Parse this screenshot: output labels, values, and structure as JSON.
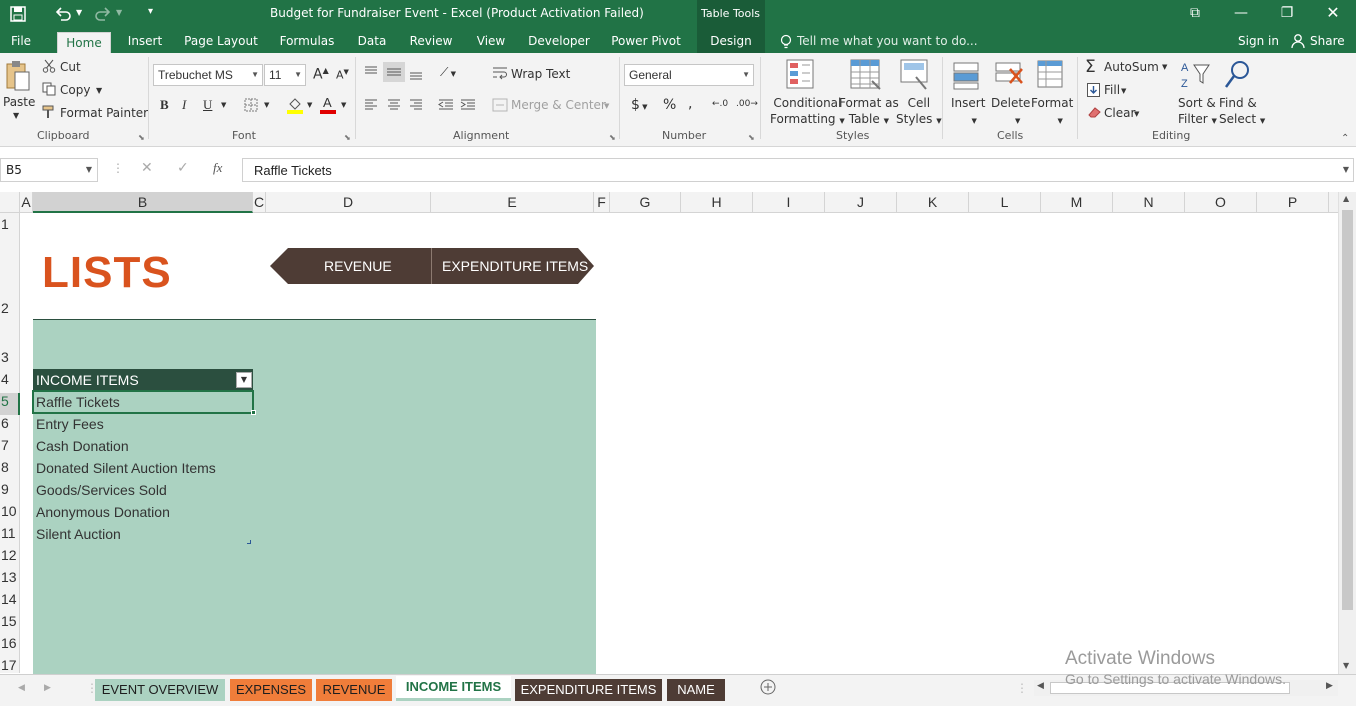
{
  "title_bar": {
    "doc_title": "Budget for Fundraiser Event - Excel (Product Activation Failed)",
    "context_tab": "Table Tools",
    "sign_in": "Sign in",
    "share": "Share"
  },
  "ribbon_tabs": [
    "File",
    "Home",
    "Insert",
    "Page Layout",
    "Formulas",
    "Data",
    "Review",
    "View",
    "Developer",
    "Power Pivot",
    "Design"
  ],
  "tell_me": "Tell me what you want to do...",
  "clipboard": {
    "paste": "Paste",
    "cut": "Cut",
    "copy": "Copy",
    "format_painter": "Format Painter",
    "label": "Clipboard"
  },
  "font": {
    "name": "Trebuchet MS",
    "size": "11",
    "label": "Font"
  },
  "alignment": {
    "wrap": "Wrap Text",
    "merge": "Merge & Center",
    "label": "Alignment"
  },
  "number": {
    "format": "General",
    "label": "Number"
  },
  "styles": {
    "cond1": "Conditional",
    "cond2": "Formatting",
    "fat1": "Format as",
    "fat2": "Table",
    "cs1": "Cell",
    "cs2": "Styles",
    "label": "Styles"
  },
  "cells": {
    "insert": "Insert",
    "delete": "Delete",
    "format": "Format",
    "label": "Cells"
  },
  "editing": {
    "autosum": "AutoSum",
    "fill": "Fill",
    "clear": "Clear",
    "sort1": "Sort &",
    "sort2": "Filter",
    "find1": "Find &",
    "find2": "Select",
    "label": "Editing"
  },
  "formula_bar": {
    "name_box": "B5",
    "fx": "fx",
    "content": "Raffle Tickets"
  },
  "columns": [
    "A",
    "B",
    "C",
    "D",
    "E",
    "F",
    "G",
    "H",
    "I",
    "J",
    "K",
    "L",
    "M",
    "N",
    "O",
    "P"
  ],
  "rows": [
    "1",
    "2",
    "3",
    "4",
    "5",
    "6",
    "7",
    "8",
    "9",
    "10",
    "11",
    "12",
    "13",
    "14",
    "15",
    "16",
    "17"
  ],
  "sheet": {
    "heading": "LISTS",
    "nav_revenue": "REVENUE",
    "nav_expenditure": "EXPENDITURE ITEMS",
    "table_header": "INCOME ITEMS",
    "items": [
      "Raffle Tickets",
      "Entry Fees",
      "Cash Donation",
      "Donated Silent Auction Items",
      "Goods/Services Sold",
      "Anonymous Donation",
      "Silent Auction"
    ]
  },
  "sheet_tabs": [
    "EVENT OVERVIEW",
    "EXPENSES",
    "REVENUE",
    "INCOME ITEMS",
    "EXPENDITURE ITEMS",
    "NAME"
  ],
  "watermark": {
    "line1": "Activate Windows",
    "line2": "Go to Settings to activate Windows."
  },
  "colors": {
    "excel_green": "#217346",
    "heading_orange": "#d9531e",
    "panel_green": "#abd2c1",
    "table_header": "#2b4f3f",
    "nav_brown": "#4e3c35",
    "tab_orange": "#f07d3a",
    "tab_green": "#abd2c1",
    "tab_brown": "#4e3c35"
  }
}
